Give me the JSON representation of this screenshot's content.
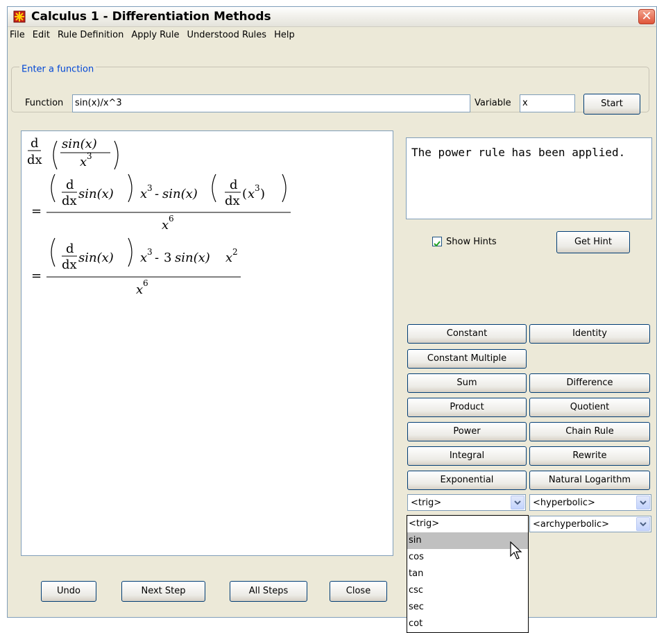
{
  "window": {
    "title": "Calculus 1 - Differentiation Methods",
    "close_glyph": "✕"
  },
  "menu": [
    "File",
    "Edit",
    "Rule Definition",
    "Apply Rule",
    "Understood Rules",
    "Help"
  ],
  "input_group": {
    "legend": "Enter a function",
    "function_label": "Function",
    "function_value": "sin(x)/x^3",
    "variable_label": "Variable",
    "variable_value": "x",
    "start_label": "Start"
  },
  "math": {
    "d": "d",
    "dx": "dx",
    "d_dx": "dx",
    "sin_x": "sin(x)",
    "x": "x",
    "exp3": "3",
    "exp6": "6",
    "exp2": "2",
    "eq": "=",
    "minus": "-",
    "three": "3"
  },
  "hint": {
    "text": "The power rule has been applied."
  },
  "show_hints": {
    "label": "Show Hints",
    "checked": true
  },
  "get_hint_label": "Get Hint",
  "rules": [
    [
      "Constant",
      "Identity"
    ],
    [
      "Constant Multiple",
      ""
    ],
    [
      "Sum",
      "Difference"
    ],
    [
      "Product",
      "Quotient"
    ],
    [
      "Power",
      "Chain Rule"
    ],
    [
      "Integral",
      "Rewrite"
    ],
    [
      "Exponential",
      "Natural Logarithm"
    ]
  ],
  "combos": {
    "trig": "<trig>",
    "hyperbolic": "<hyperbolic>",
    "archyperbolic": "<archyperbolic>"
  },
  "trig_options": [
    "<trig>",
    "sin",
    "cos",
    "tan",
    "csc",
    "sec",
    "cot"
  ],
  "trig_highlighted": "sin",
  "bottom_buttons": {
    "undo": "Undo",
    "next_step": "Next Step",
    "all_steps": "All Steps",
    "close": "Close"
  }
}
